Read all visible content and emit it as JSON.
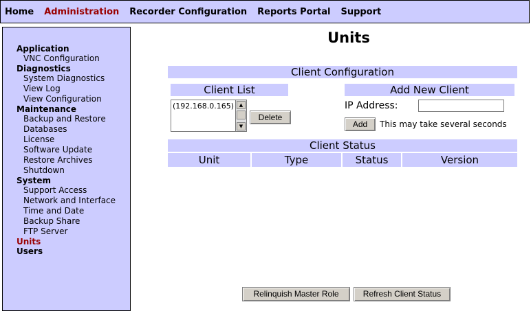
{
  "topnav": {
    "items": [
      "Home",
      "Administration",
      "Recorder Configuration",
      "Reports Portal",
      "Support"
    ],
    "active_index": 1
  },
  "sidebar": {
    "sections": [
      {
        "label": "Application",
        "items": [
          "VNC Configuration"
        ]
      },
      {
        "label": "Diagnostics",
        "items": [
          "System Diagnostics",
          "View Log",
          "View Configuration"
        ]
      },
      {
        "label": "Maintenance",
        "items": [
          "Backup and Restore",
          "Databases",
          "License",
          "Software Update",
          "Restore Archives",
          "Shutdown"
        ]
      },
      {
        "label": "System",
        "items": [
          "Support Access",
          "Network and Interface",
          "Time and Date",
          "Backup Share",
          "FTP Server"
        ]
      },
      {
        "label": "Units",
        "items": [],
        "active": true
      },
      {
        "label": "Users",
        "items": []
      }
    ]
  },
  "page": {
    "title": "Units"
  },
  "client_configuration": {
    "header": "Client Configuration",
    "client_list": {
      "header": "Client List",
      "entries": [
        "(192.168.0.165)"
      ],
      "delete_label": "Delete"
    },
    "add_new_client": {
      "header": "Add New Client",
      "ip_label": "IP Address:",
      "ip_value": "",
      "add_label": "Add",
      "note": "This may take several seconds"
    }
  },
  "client_status": {
    "header": "Client Status",
    "columns": [
      "Unit",
      "Type",
      "Status",
      "Version"
    ]
  },
  "footer_buttons": {
    "relinquish_label": "Relinquish Master Role",
    "refresh_label": "Refresh Client Status"
  }
}
